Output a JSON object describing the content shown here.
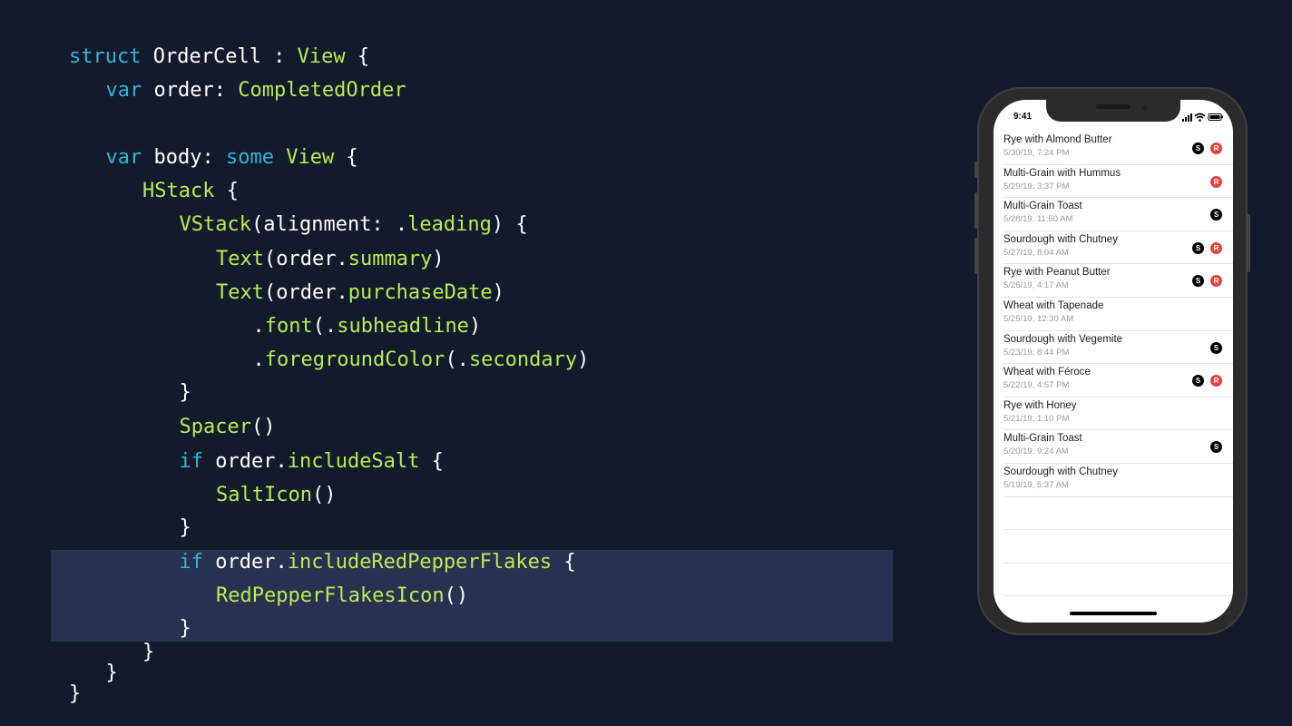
{
  "code": {
    "lines": [
      [
        {
          "t": "struct",
          "c": "kw"
        },
        {
          "t": " OrderCell : ",
          "c": "pl"
        },
        {
          "t": "View",
          "c": "ty"
        },
        {
          "t": " {",
          "c": "pl"
        }
      ],
      [
        {
          "t": "var",
          "c": "kw"
        },
        {
          "t": " order: ",
          "c": "pl"
        },
        {
          "t": "CompletedOrder",
          "c": "ty"
        }
      ],
      [],
      [
        {
          "t": "var",
          "c": "kw"
        },
        {
          "t": " body: ",
          "c": "pl"
        },
        {
          "t": "some",
          "c": "kw"
        },
        {
          "t": " ",
          "c": "pl"
        },
        {
          "t": "View",
          "c": "ty"
        },
        {
          "t": " {",
          "c": "pl"
        }
      ],
      [
        {
          "t": "HStack",
          "c": "ty"
        },
        {
          "t": " {",
          "c": "pl"
        }
      ],
      [
        {
          "t": "VStack",
          "c": "ty"
        },
        {
          "t": "(alignment: .",
          "c": "pl"
        },
        {
          "t": "leading",
          "c": "ty"
        },
        {
          "t": ") {",
          "c": "pl"
        }
      ],
      [
        {
          "t": "Text",
          "c": "ty"
        },
        {
          "t": "(order.",
          "c": "pl"
        },
        {
          "t": "summary",
          "c": "ty"
        },
        {
          "t": ")",
          "c": "pl"
        }
      ],
      [
        {
          "t": "Text",
          "c": "ty"
        },
        {
          "t": "(order.",
          "c": "pl"
        },
        {
          "t": "purchaseDate",
          "c": "ty"
        },
        {
          "t": ")",
          "c": "pl"
        }
      ],
      [
        {
          "t": ".",
          "c": "pl"
        },
        {
          "t": "font",
          "c": "ty"
        },
        {
          "t": "(.",
          "c": "pl"
        },
        {
          "t": "subheadline",
          "c": "ty"
        },
        {
          "t": ")",
          "c": "pl"
        }
      ],
      [
        {
          "t": ".",
          "c": "pl"
        },
        {
          "t": "foregroundColor",
          "c": "ty"
        },
        {
          "t": "(.",
          "c": "pl"
        },
        {
          "t": "secondary",
          "c": "ty"
        },
        {
          "t": ")",
          "c": "pl"
        }
      ],
      [
        {
          "t": "}",
          "c": "pl"
        }
      ],
      [
        {
          "t": "Spacer",
          "c": "ty"
        },
        {
          "t": "()",
          "c": "pl"
        }
      ],
      [
        {
          "t": "if",
          "c": "kw"
        },
        {
          "t": " order.",
          "c": "pl"
        },
        {
          "t": "includeSalt",
          "c": "ty"
        },
        {
          "t": " {",
          "c": "pl"
        }
      ],
      [
        {
          "t": "SaltIcon",
          "c": "ty"
        },
        {
          "t": "()",
          "c": "pl"
        }
      ],
      [
        {
          "t": "}",
          "c": "pl"
        }
      ],
      [
        {
          "t": "if",
          "c": "kw"
        },
        {
          "t": " order.",
          "c": "pl"
        },
        {
          "t": "includeRedPepperFlakes",
          "c": "ty"
        },
        {
          "t": " {",
          "c": "pl"
        }
      ],
      [
        {
          "t": "RedPepperFlakesIcon",
          "c": "ty"
        },
        {
          "t": "()",
          "c": "pl"
        }
      ],
      [
        {
          "t": "}",
          "c": "pl"
        }
      ],
      [
        {
          "t": "}",
          "c": "pl"
        }
      ],
      [
        {
          "t": "}",
          "c": "pl"
        }
      ],
      [
        {
          "t": "}",
          "c": "pl"
        }
      ]
    ]
  },
  "phone": {
    "time": "9:41",
    "salt_icon_letter": "S",
    "pepper_icon_letter": "R",
    "colors": {
      "salt": "#000000",
      "pepper": "#e94040"
    },
    "orders": [
      {
        "summary": "Rye with Almond Butter",
        "date": "5/30/19, 7:24 PM",
        "salt": true,
        "pepper": true
      },
      {
        "summary": "Multi-Grain with Hummus",
        "date": "5/29/19, 3:37 PM",
        "salt": false,
        "pepper": true
      },
      {
        "summary": "Multi-Grain Toast",
        "date": "5/28/19, 11:50 AM",
        "salt": true,
        "pepper": false
      },
      {
        "summary": "Sourdough with Chutney",
        "date": "5/27/19, 8:04 AM",
        "salt": true,
        "pepper": true
      },
      {
        "summary": "Rye with Peanut Butter",
        "date": "5/26/19, 4:17 AM",
        "salt": true,
        "pepper": true
      },
      {
        "summary": "Wheat with Tapenade",
        "date": "5/25/19, 12:30 AM",
        "salt": false,
        "pepper": false
      },
      {
        "summary": "Sourdough with Vegemite",
        "date": "5/23/19, 8:44 PM",
        "salt": true,
        "pepper": false
      },
      {
        "summary": "Wheat with Féroce",
        "date": "5/22/19, 4:57 PM",
        "salt": true,
        "pepper": true
      },
      {
        "summary": "Rye with Honey",
        "date": "5/21/19, 1:10 PM",
        "salt": false,
        "pepper": false
      },
      {
        "summary": "Multi-Grain Toast",
        "date": "5/20/19, 9:24 AM",
        "salt": true,
        "pepper": false
      },
      {
        "summary": "Sourdough with Chutney",
        "date": "5/19/19, 5:37 AM",
        "salt": false,
        "pepper": false
      }
    ],
    "empty_rows": 3
  }
}
